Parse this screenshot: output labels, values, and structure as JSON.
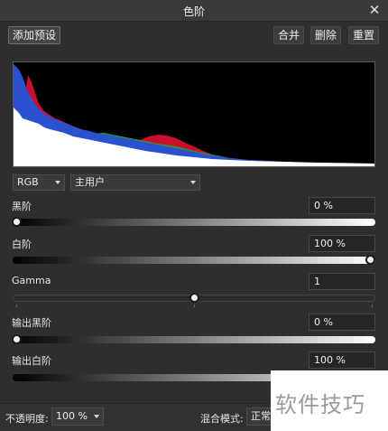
{
  "window": {
    "title": "色阶",
    "close_glyph": "✕"
  },
  "toolbar": {
    "add_preset": "添加预设",
    "merge": "合并",
    "delete": "删除",
    "reset": "重置"
  },
  "histogram": {
    "colors": {
      "red": "#c8102e",
      "green": "#2aa02a",
      "blue": "#2a52d0",
      "luminance": "#ffffff"
    }
  },
  "channel": {
    "selected": "RGB"
  },
  "profile": {
    "selected": "主用户"
  },
  "black_level": {
    "label": "黑阶",
    "value": "0 %",
    "level": 0.0
  },
  "white_level": {
    "label": "白阶",
    "value": "100 %",
    "level": 1.0
  },
  "gamma": {
    "label": "Gamma",
    "value": "1",
    "level": 0.5
  },
  "output_black": {
    "label": "输出黑阶",
    "value": "0 %",
    "level": 0.0
  },
  "output_white": {
    "label": "输出白阶",
    "value": "100 %",
    "level": 1.0
  },
  "footer": {
    "opacity_label": "不透明度:",
    "opacity_value": "100 %",
    "blend_label": "混合模式:",
    "blend_value": "正常"
  },
  "watermark": {
    "text": "软件技巧"
  }
}
